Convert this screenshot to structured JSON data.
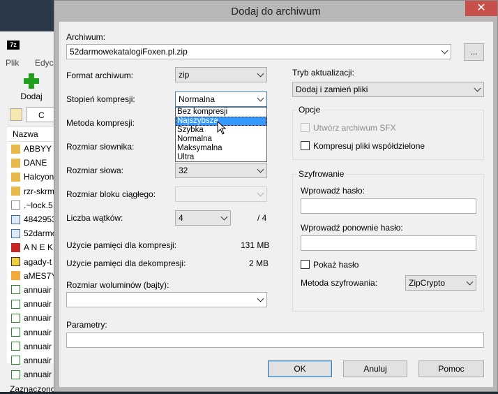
{
  "background_window": {
    "menu": [
      "Plik",
      "Edyc"
    ],
    "add_label": "Dodaj",
    "nav_c_label": "C",
    "list_header": "Nazwa",
    "files": [
      {
        "name": "ABBYY",
        "icon": "folder-icon"
      },
      {
        "name": "DANE",
        "icon": "folder-icon"
      },
      {
        "name": "Halcyon",
        "icon": "folder-icon"
      },
      {
        "name": "rzr-skrm",
        "icon": "folder-icon"
      },
      {
        "name": ".~lock.5",
        "icon": "file-icon"
      },
      {
        "name": "4842953",
        "icon": "document-icon"
      },
      {
        "name": "52darmo",
        "icon": "document-icon"
      },
      {
        "name": "A N E K",
        "icon": "acrobat-icon"
      },
      {
        "name": "agady-t",
        "icon": "pdf-icon"
      },
      {
        "name": "aMES7Y",
        "icon": "image-icon"
      },
      {
        "name": "annuair",
        "icon": "spreadsheet-icon"
      },
      {
        "name": "annuair",
        "icon": "spreadsheet-icon"
      },
      {
        "name": "annuair",
        "icon": "spreadsheet-icon"
      },
      {
        "name": "annuair",
        "icon": "spreadsheet-icon"
      },
      {
        "name": "annuair",
        "icon": "spreadsheet-icon"
      },
      {
        "name": "annuair",
        "icon": "spreadsheet-icon"
      },
      {
        "name": "annuair",
        "icon": "spreadsheet-icon"
      }
    ],
    "status": "Zaznaczono"
  },
  "dialog": {
    "title": "Dodaj do archiwum",
    "close_glyph": "✕",
    "archive_label": "Archiwum:",
    "archive_value": "52darmowekatalogiFoxen.pl.zip",
    "browse_label": "...",
    "format_label": "Format archiwum:",
    "format_value": "zip",
    "level_label": "Stopień kompresji:",
    "level_value": "Normalna",
    "level_options": [
      "Bez kompresji",
      "Najszybsza",
      "Szybka",
      "Normalna",
      "Maksymalna",
      "Ultra"
    ],
    "level_highlighted": "Najszybsza",
    "method_label": "Metoda kompresji:",
    "dict_label": "Rozmiar słownika:",
    "word_label": "Rozmiar słowa:",
    "word_value": "32",
    "solid_label": "Rozmiar bloku ciągłego:",
    "threads_label": "Liczba wątków:",
    "threads_value": "4",
    "threads_max": "/ 4",
    "mem_compress_label": "Użycie pamięci dla kompresji:",
    "mem_compress_value": "131 MB",
    "mem_decompress_label": "Użycie pamięci dla dekompresji:",
    "mem_decompress_value": "2 MB",
    "volume_label": "Rozmiar woluminów (bajty):",
    "params_label": "Parametry:",
    "update_label": "Tryb aktualizacji:",
    "update_value": "Dodaj i zamień pliki",
    "options_title": "Opcje",
    "sfx_label": "Utwórz archiwum SFX",
    "shared_label": "Kompresuj pliki współdzielone",
    "encryption_title": "Szyfrowanie",
    "password_label": "Wprowadź hasło:",
    "password_repeat_label": "Wprowadź ponownie hasło:",
    "show_password_label": "Pokaż hasło",
    "enc_method_label": "Metoda szyfrowania:",
    "enc_method_value": "ZipCrypto",
    "ok_label": "OK",
    "cancel_label": "Anuluj",
    "help_label": "Pomoc"
  }
}
